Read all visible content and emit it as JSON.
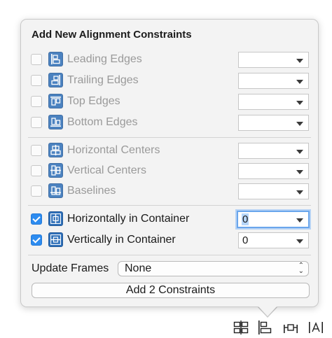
{
  "title": "Add New Alignment Constraints",
  "rows": [
    {
      "label": "Leading Edges",
      "checked": false,
      "enabled": false,
      "value": "",
      "icon": "leading-edges-icon"
    },
    {
      "label": "Trailing Edges",
      "checked": false,
      "enabled": false,
      "value": "",
      "icon": "trailing-edges-icon"
    },
    {
      "label": "Top Edges",
      "checked": false,
      "enabled": false,
      "value": "",
      "icon": "top-edges-icon"
    },
    {
      "label": "Bottom Edges",
      "checked": false,
      "enabled": false,
      "value": "",
      "icon": "bottom-edges-icon"
    },
    {
      "label": "Horizontal Centers",
      "checked": false,
      "enabled": false,
      "value": "",
      "icon": "horizontal-centers-icon"
    },
    {
      "label": "Vertical Centers",
      "checked": false,
      "enabled": false,
      "value": "",
      "icon": "vertical-centers-icon"
    },
    {
      "label": "Baselines",
      "checked": false,
      "enabled": false,
      "value": "",
      "icon": "baselines-icon"
    },
    {
      "label": "Horizontally in Container",
      "checked": true,
      "enabled": true,
      "value": "0",
      "icon": "horizontally-in-container-icon"
    },
    {
      "label": "Vertically in Container",
      "checked": true,
      "enabled": true,
      "value": "0",
      "icon": "vertically-in-container-icon"
    }
  ],
  "update_frames": {
    "label": "Update Frames",
    "value": "None"
  },
  "add_button": "Add 2 Constraints",
  "colors": {
    "accent": "#2d8cf0",
    "icon_blue": "#2e6fb8",
    "disabled_text": "#9a9a9a"
  },
  "toolbar_icons": [
    "align-icon",
    "pin-icon",
    "resolve-issues-icon",
    "resizing-behavior-icon"
  ]
}
